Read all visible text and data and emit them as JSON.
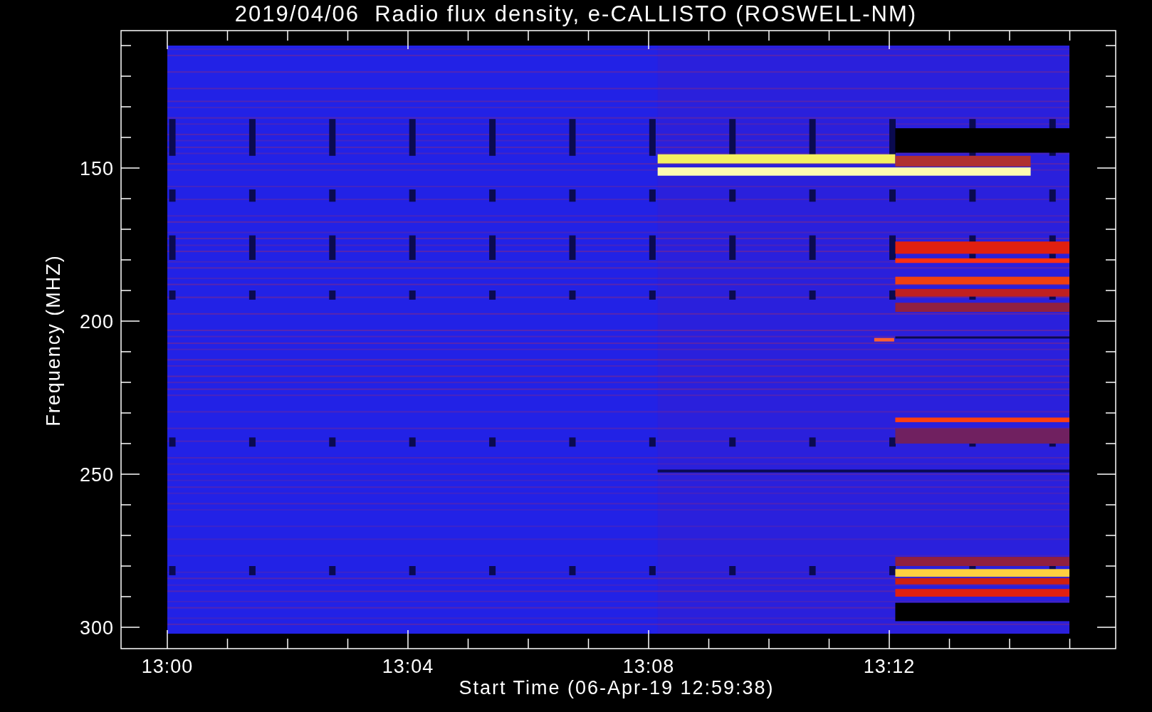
{
  "title": "2019/04/06  Radio flux density, e-CALLISTO (ROSWELL-NM)",
  "y_axis": {
    "label": "Frequency (MHZ)",
    "ticks": [
      "150",
      "200",
      "250",
      "300"
    ]
  },
  "x_axis": {
    "label": "Start Time (06-Apr-19 12:59:38)",
    "ticks": [
      "13:00",
      "13:04",
      "13:08",
      "13:12"
    ]
  }
}
